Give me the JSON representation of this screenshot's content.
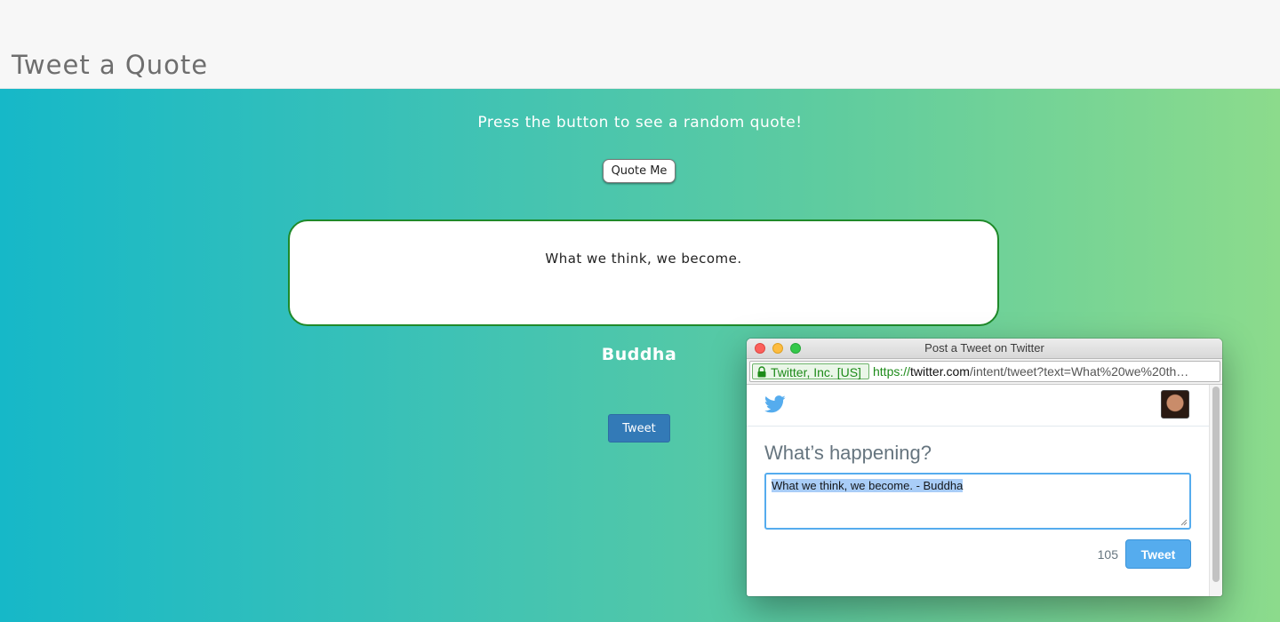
{
  "app": {
    "title": "Tweet a Quote",
    "prompt": "Press the button to see a random quote!",
    "quote_button_label": "Quote Me",
    "quote_text": "What we think, we become.",
    "author": "Buddha",
    "tweet_button_label": "Tweet"
  },
  "colors": {
    "gradient_start": "#16b8c8",
    "gradient_end": "#8cdb8c",
    "quote_border": "#1f8a2a",
    "tweet_button": "#337ab7",
    "twitter_blue": "#55acee"
  },
  "popup": {
    "window_title": "Post a Tweet on Twitter",
    "certificate": "Twitter, Inc. [US]",
    "url_scheme": "https://",
    "url_host": "twitter.com",
    "url_path": "/intent/tweet?text=What%20we%20th…",
    "heading": "What’s happening?",
    "tweet_text": "What we think, we become.  - Buddha",
    "char_count": "105",
    "tweet_button_label": "Tweet",
    "icons": {
      "bird": "twitter-bird-icon",
      "lock": "lock-icon"
    }
  }
}
